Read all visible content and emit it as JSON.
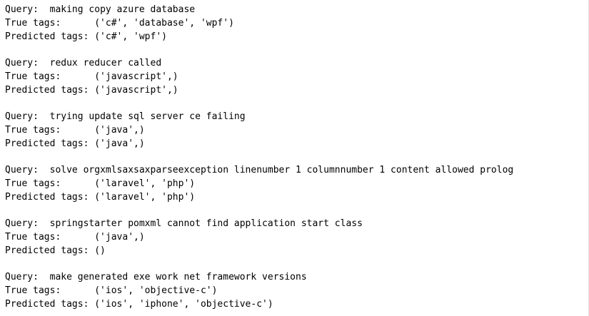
{
  "results": [
    {
      "query_label": "Query:  ",
      "query": "making copy azure database",
      "true_label": "True tags:      ",
      "true_tags": "('c#', 'database', 'wpf')",
      "pred_label": "Predicted tags: ",
      "pred_tags": "('c#', 'wpf')"
    },
    {
      "query_label": "Query:  ",
      "query": "redux reducer called",
      "true_label": "True tags:      ",
      "true_tags": "('javascript',)",
      "pred_label": "Predicted tags: ",
      "pred_tags": "('javascript',)"
    },
    {
      "query_label": "Query:  ",
      "query": "trying update sql server ce failing",
      "true_label": "True tags:      ",
      "true_tags": "('java',)",
      "pred_label": "Predicted tags: ",
      "pred_tags": "('java',)"
    },
    {
      "query_label": "Query:  ",
      "query": "solve orgxmlsaxsaxparseexception linenumber 1 columnnumber 1 content allowed prolog",
      "true_label": "True tags:      ",
      "true_tags": "('laravel', 'php')",
      "pred_label": "Predicted tags: ",
      "pred_tags": "('laravel', 'php')"
    },
    {
      "query_label": "Query:  ",
      "query": "springstarter pomxml cannot find application start class",
      "true_label": "True tags:      ",
      "true_tags": "('java',)",
      "pred_label": "Predicted tags: ",
      "pred_tags": "()"
    },
    {
      "query_label": "Query:  ",
      "query": "make generated exe work net framework versions",
      "true_label": "True tags:      ",
      "true_tags": "('ios', 'objective-c')",
      "pred_label": "Predicted tags: ",
      "pred_tags": "('ios', 'iphone', 'objective-c')"
    }
  ]
}
